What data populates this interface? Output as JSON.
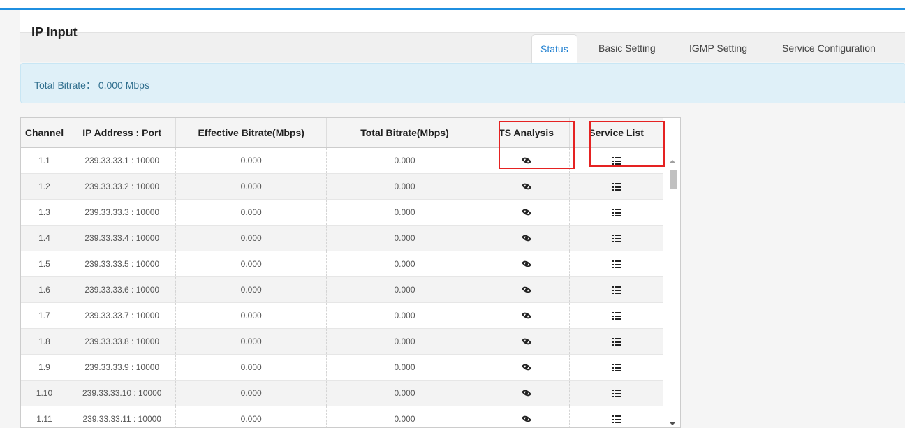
{
  "panel": {
    "title": "IP Input"
  },
  "tabs": [
    {
      "label": "Status",
      "active": true
    },
    {
      "label": "Basic Setting",
      "active": false
    },
    {
      "label": "IGMP Setting",
      "active": false
    },
    {
      "label": "Service Configuration",
      "active": false
    }
  ],
  "alert": {
    "text": "Total Bitrate： 0.000 Mbps"
  },
  "table": {
    "headers": [
      "Channel",
      "IP Address : Port",
      "Effective Bitrate(Mbps)",
      "Total Bitrate(Mbps)",
      "TS Analysis",
      "Service List"
    ],
    "rows": [
      {
        "channel": "1.1",
        "address": "239.33.33.1 : 10000",
        "effective": "0.000",
        "total": "0.000"
      },
      {
        "channel": "1.2",
        "address": "239.33.33.2 : 10000",
        "effective": "0.000",
        "total": "0.000"
      },
      {
        "channel": "1.3",
        "address": "239.33.33.3 : 10000",
        "effective": "0.000",
        "total": "0.000"
      },
      {
        "channel": "1.4",
        "address": "239.33.33.4 : 10000",
        "effective": "0.000",
        "total": "0.000"
      },
      {
        "channel": "1.5",
        "address": "239.33.33.5 : 10000",
        "effective": "0.000",
        "total": "0.000"
      },
      {
        "channel": "1.6",
        "address": "239.33.33.6 : 10000",
        "effective": "0.000",
        "total": "0.000"
      },
      {
        "channel": "1.7",
        "address": "239.33.33.7 : 10000",
        "effective": "0.000",
        "total": "0.000"
      },
      {
        "channel": "1.8",
        "address": "239.33.33.8 : 10000",
        "effective": "0.000",
        "total": "0.000"
      },
      {
        "channel": "1.9",
        "address": "239.33.33.9 : 10000",
        "effective": "0.000",
        "total": "0.000"
      },
      {
        "channel": "1.10",
        "address": "239.33.33.10 : 10000",
        "effective": "0.000",
        "total": "0.000"
      },
      {
        "channel": "1.11",
        "address": "239.33.33.11 : 10000",
        "effective": "0.000",
        "total": "0.000"
      }
    ],
    "ts_icon": "eye-icon",
    "service_icon": "list-icon"
  },
  "colors": {
    "accent": "#1f8fe0",
    "active_tab": "#1f7fd0",
    "alert_bg": "#dff0f8",
    "alert_text": "#31708f",
    "highlight": "#e52222"
  }
}
